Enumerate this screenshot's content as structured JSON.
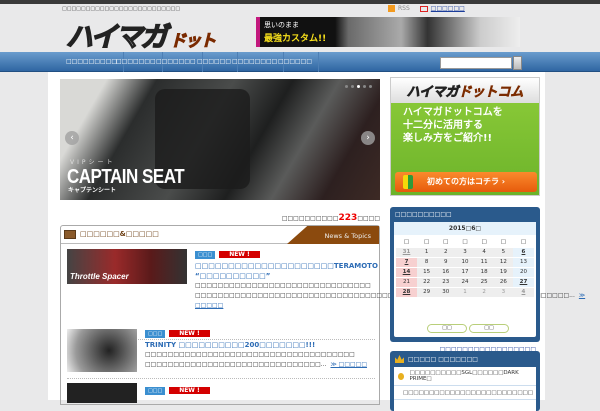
{
  "header": {
    "tagline": "□□□□□□□□□□□□□□□□□□□□□□□□□",
    "logo_main": "ハイマガ",
    "logo_sub": "ドットコム",
    "rss": "RSS",
    "contact": "□□□□□□",
    "banner_line1": "思いのまま",
    "banner_line2": "最強カスタム!!"
  },
  "nav": {
    "items": [
      "□□□□□□□□□",
      "□□□□□□□",
      "□□□□□□□",
      "□□□□□□",
      "□□□□□□□□",
      "□□□□□□"
    ],
    "search_value": ""
  },
  "slider": {
    "sub": "VIPシート",
    "title": "CAPTAIN SEAT",
    "kana": "キャプテンシート",
    "prev": "‹",
    "next": "›"
  },
  "promo": {
    "logo_main": "ハイマガ",
    "logo_sub": "ドットコム",
    "lines": [
      "ハイマガドットコムを",
      "十二分に活用する",
      "楽しみ方をご紹介!!"
    ],
    "button": "初めての方はコチラ ›"
  },
  "count": {
    "prefix": "□□□□□□□□□□",
    "value": "223",
    "suffix": "□□□□"
  },
  "news": {
    "title": "□□□□□□&□□□□□",
    "tab": "News & Topics",
    "items": [
      {
        "category": "□□□",
        "badge": "NEW !",
        "title": "□□□□□□□□□□□□□□□□□□□□□TERAMOTO “□□□□□□□□□□”",
        "text": "□□□□□□□□□□□□□□□□□□□□□□□□□□□□□□□ □□□□□□□□□□□□□□□□□□□□□□□□□□□□□□□□□□□□□□□□□□□□□□□□□□□□□□□□□□□□□□□□□□...",
        "more": "≫ □□□□□",
        "thumb": "Throttle Spacer"
      },
      {
        "category": "□□□",
        "badge": "NEW !",
        "title": "TRINITY □□□□□□□□□□200□□□□□□□!!!",
        "text": "□□□□□□□□□□□□□□□□□□□□□□□□□□□□□□□□□□□□□ □□□□□□□□□□□□□□□□□□□□□□□□□□□□□□□...",
        "more": "≫ □□□□□"
      },
      {
        "category": "□□□",
        "badge": "NEW !"
      }
    ]
  },
  "calendar": {
    "heading": "□□□□□□□□□□",
    "month": "2015□6□",
    "weekdays": [
      "□",
      "□",
      "□",
      "□",
      "□",
      "□",
      "□"
    ],
    "weeks": [
      [
        "31",
        "1",
        "2",
        "3",
        "4",
        "5",
        "6"
      ],
      [
        "7",
        "8",
        "9",
        "10",
        "11",
        "12",
        "13"
      ],
      [
        "14",
        "15",
        "16",
        "17",
        "18",
        "19",
        "20"
      ],
      [
        "21",
        "22",
        "23",
        "24",
        "25",
        "26",
        "27"
      ],
      [
        "28",
        "29",
        "30",
        "1",
        "2",
        "3",
        "4"
      ]
    ],
    "prev": "□□",
    "next": "□□",
    "link": "□□□□□□□□□□□□□□□□□"
  },
  "ranking": {
    "heading": "□□□□□ □□□□□□□",
    "items": [
      "□□□□□□□□□□SGL□□□□□□DARK PRIME□",
      "□□□□□□□□□□□□□□□□□□□□□□□□□"
    ]
  }
}
